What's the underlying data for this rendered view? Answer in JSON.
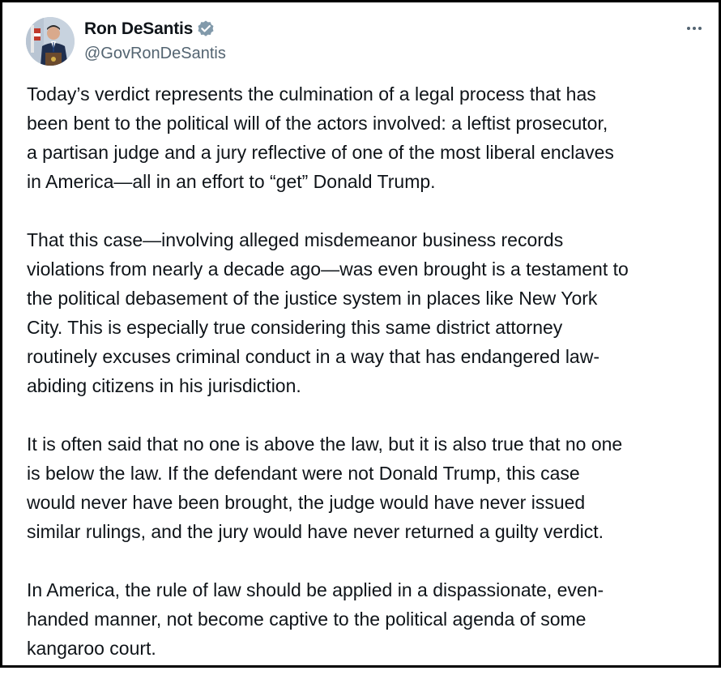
{
  "author": {
    "display_name": "Ron DeSantis",
    "handle": "@GovRonDeSantis",
    "verified_icon": "verified-badge-icon",
    "badge_color": "#829aab"
  },
  "menu": {
    "icon": "more-options-icon"
  },
  "post": {
    "paragraphs": [
      {
        "lines": [
          "Today’s verdict represents the culmination of a legal process that has",
          "been bent to the political will of the actors involved: a leftist prosecutor,",
          "a partisan judge and a jury reflective of one of the most liberal enclaves",
          "in America—all in an effort to “get” Donald Trump."
        ]
      },
      {
        "lines": [
          "That this case—involving alleged misdemeanor business records",
          "violations from nearly a decade ago—was even brought is a testament to",
          "the political debasement of the justice system in places like New York",
          "City. This is especially true considering this same district attorney",
          "routinely excuses criminal conduct in a way that has endangered law-",
          "abiding citizens in his jurisdiction."
        ]
      },
      {
        "lines": [
          "It is often said that no one is above the law, but it is also true that no one",
          "is below the law. If the defendant were not Donald Trump, this case",
          "would never have been brought, the judge would have never issued",
          "similar rulings, and the jury would have never returned a guilty verdict."
        ]
      },
      {
        "lines": [
          "In America, the rule of law should be applied in a dispassionate, even-",
          "handed manner, not become captive to the political agenda of some",
          "kangaroo court."
        ]
      }
    ]
  },
  "colors": {
    "text": "#0f1419",
    "secondary": "#536471",
    "frame": "#000000"
  }
}
